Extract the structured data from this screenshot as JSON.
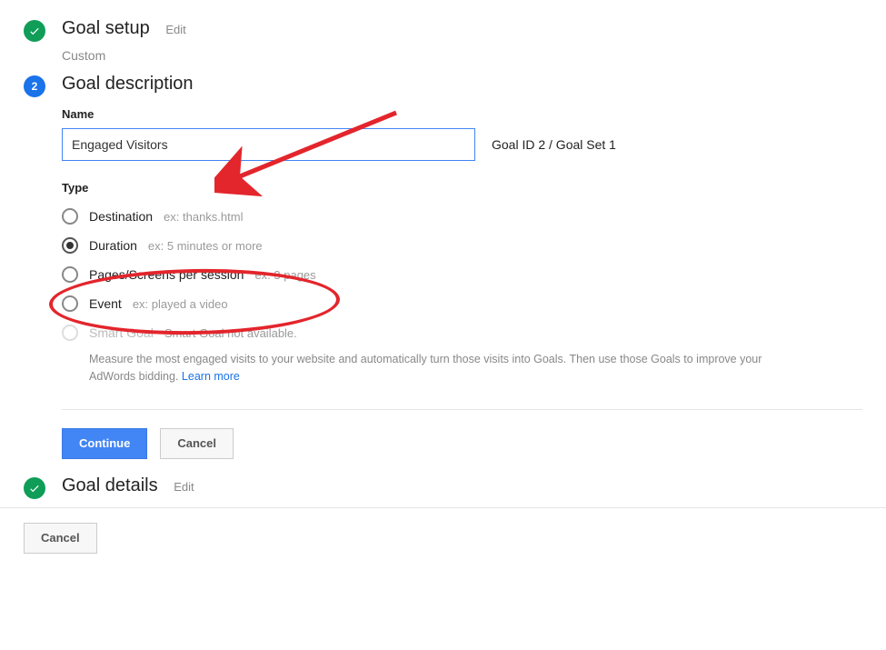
{
  "steps": {
    "setup": {
      "title": "Goal setup",
      "edit": "Edit",
      "subtitle": "Custom"
    },
    "description": {
      "number": "2",
      "title": "Goal description",
      "name_label": "Name",
      "name_value": "Engaged Visitors",
      "goal_id_text": "Goal ID 2 / Goal Set 1",
      "type_label": "Type",
      "options": {
        "destination": {
          "label": "Destination",
          "hint": "ex: thanks.html"
        },
        "duration": {
          "label": "Duration",
          "hint": "ex: 5 minutes or more"
        },
        "pages": {
          "label": "Pages/Screens per session",
          "hint": "ex: 3 pages"
        },
        "event": {
          "label": "Event",
          "hint": "ex: played a video"
        },
        "smart": {
          "label": "Smart Goal",
          "hint": "Smart Goal not available."
        }
      },
      "smart_desc": "Measure the most engaged visits to your website and automatically turn those visits into Goals. Then use those Goals to improve your AdWords bidding. ",
      "learn_more": "Learn more",
      "continue": "Continue",
      "cancel": "Cancel"
    },
    "details": {
      "title": "Goal details",
      "edit": "Edit"
    }
  },
  "bottom_cancel": "Cancel",
  "colors": {
    "accent_blue": "#4285f4",
    "accent_green": "#0f9d58",
    "annotate_red": "#e3252c"
  }
}
